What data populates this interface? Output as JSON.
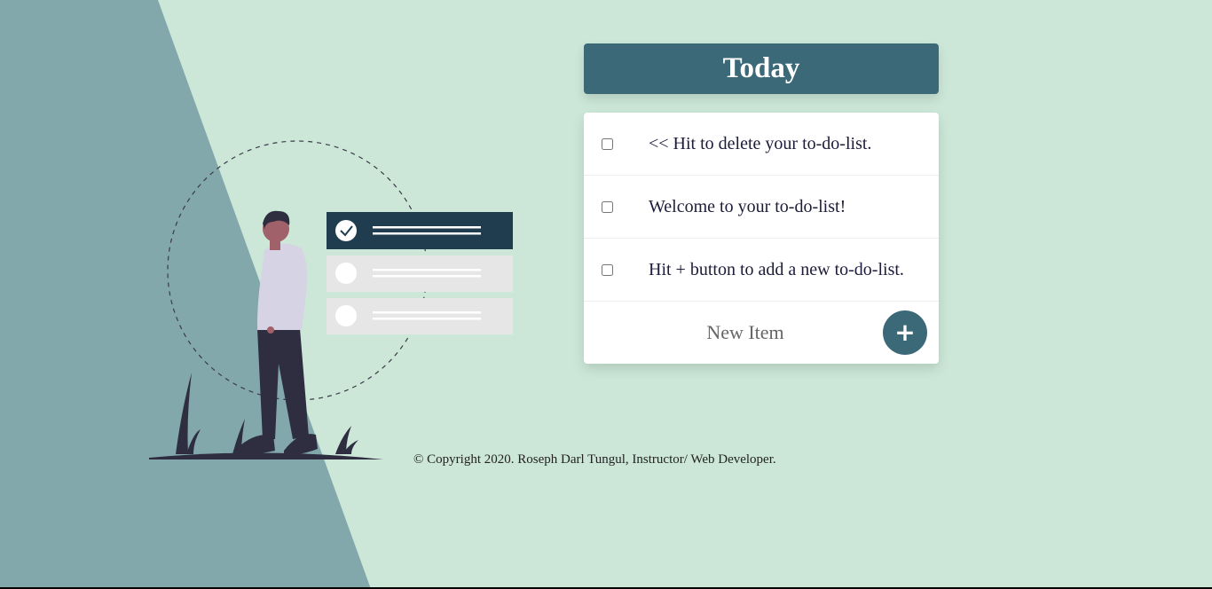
{
  "header": {
    "title": "Today"
  },
  "todo": {
    "items": [
      {
        "text": "<< Hit to delete your to-do-list.",
        "checked": false
      },
      {
        "text": "Welcome to your to-do-list!",
        "checked": false
      },
      {
        "text": "Hit + button to add a new to-do-list.",
        "checked": false
      }
    ],
    "new_item_placeholder": "New Item",
    "add_button_label": "+"
  },
  "footer": {
    "copyright": "© Copyright 2020. Roseph Darl Tungul, Instructor/ Web Developer."
  },
  "colors": {
    "background": "#cce7d8",
    "left_panel": "#82a8ac",
    "accent": "#3b6977",
    "card": "#ffffff",
    "illustration_dark": "#1f3d4f"
  }
}
